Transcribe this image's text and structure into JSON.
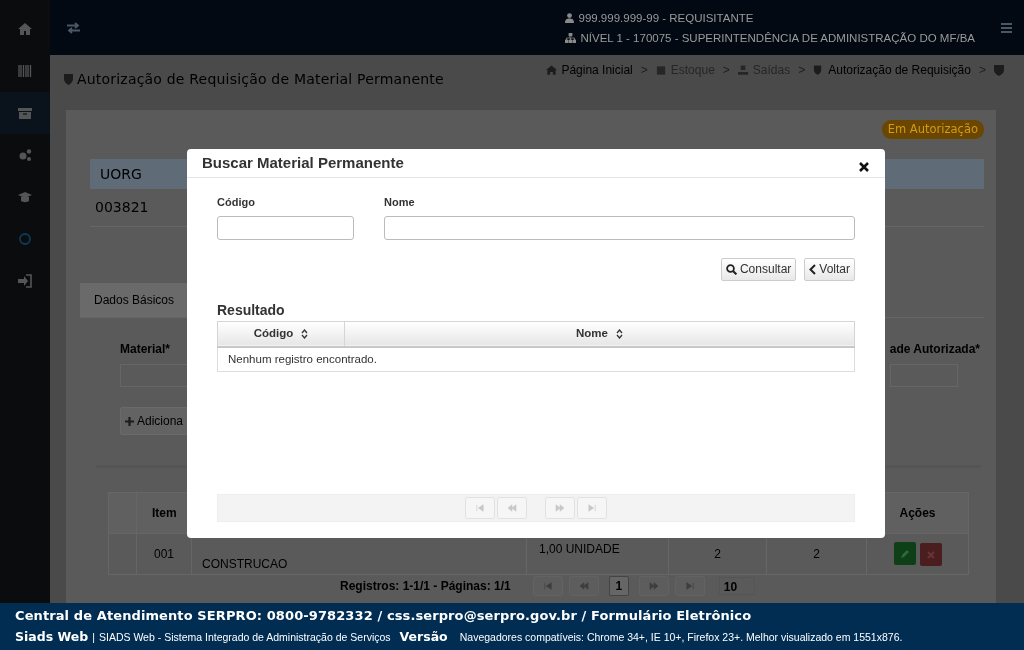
{
  "sidebar": {
    "items": [
      {
        "selected": false
      },
      {
        "selected": false
      },
      {
        "selected": true
      },
      {
        "selected": false
      },
      {
        "selected": false
      },
      {
        "selected": false
      },
      {
        "selected": false
      }
    ]
  },
  "topbar": {
    "user": "999.999.999-99 - REQUISITANTE",
    "unit": "NÍVEL 1 - 170075 - SUPERINTENDÊNCIA DE ADMINISTRAÇÃO DO MF/BA"
  },
  "page": {
    "title": "Autorização de Requisição de Material Permanente",
    "breadcrumb": [
      {
        "label": "Página Inicial",
        "disabled": false
      },
      {
        "label": "Estoque",
        "disabled": true
      },
      {
        "label": "Saídas",
        "disabled": true
      },
      {
        "label": "Autorização de Requisição",
        "disabled": false
      }
    ],
    "breadcrumb_separator": ">"
  },
  "status_badge": "Em Autorização",
  "uorg": {
    "label": "UORG",
    "value": "003821"
  },
  "tabs": [
    {
      "label": "Dados Básicos",
      "selected": true
    }
  ],
  "form": {
    "material_label": "Material*",
    "quantity_label": "ade Autorizada*",
    "add_button": "Adiciona"
  },
  "items_table": {
    "columns": [
      "Item",
      "Ações"
    ],
    "rows": [
      {
        "item": "001",
        "description": "CONSTRUCAO",
        "unit": "1,00 UNIDADE",
        "column_4": "2",
        "column_5": "2"
      }
    ],
    "summary": "Registros: 1-1/1 - Páginas: 1/1",
    "pages": [
      {
        "label": "1",
        "selected": true
      }
    ],
    "page_size": "10"
  },
  "modal": {
    "title": "Buscar Material Permanente",
    "fields": [
      {
        "label": "Código"
      },
      {
        "label": "Nome"
      }
    ],
    "buttons": [
      {
        "kind": "search",
        "label": "Consultar"
      },
      {
        "kind": "back",
        "label": "Voltar"
      }
    ],
    "result_title": "Resultado",
    "columns": [
      "Código",
      "Nome"
    ],
    "empty": "Nenhum registro encontrado."
  },
  "footer": {
    "contact": "Central de Atendimento SERPRO: 0800-9782332 / css.serpro@serpro.gov.br / Formulário Eletrônico",
    "app": "Siads Web",
    "separator": "|",
    "app_full": "SIADS Web - Sistema Integrado de Administração de Serviços",
    "version_label": "Versão",
    "browsers": "Navegadores compatíveis: Chrome 34+, IE 10+, Firefox 23+. Melhor visualizado em 1551x876."
  }
}
